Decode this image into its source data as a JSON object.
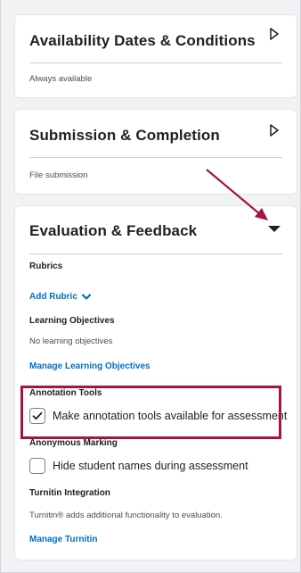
{
  "cards": {
    "availability": {
      "title": "Availability Dates & Conditions",
      "summary": "Always available",
      "icon": "triangle-right-outline-icon"
    },
    "submission": {
      "title": "Submission & Completion",
      "summary": "File submission",
      "icon": "triangle-right-outline-icon"
    },
    "evaluation": {
      "title": "Evaluation & Feedback",
      "icon": "triangle-down-filled-icon",
      "rubrics": {
        "label": "Rubrics",
        "add_link": "Add Rubric"
      },
      "learning_objectives": {
        "label": "Learning Objectives",
        "empty_text": "No learning objectives",
        "manage_link": "Manage Learning Objectives"
      },
      "annotation_tools": {
        "label": "Annotation Tools",
        "checkbox_label": "Make annotation tools available for assessment",
        "checked": true
      },
      "anonymous_marking": {
        "label": "Anonymous Marking",
        "checkbox_label": "Hide student names during assessment",
        "checked": false
      },
      "turnitin": {
        "label": "Turnitin Integration",
        "description": "Turnitin® adds additional functionality to evaluation.",
        "manage_link": "Manage Turnitin"
      }
    }
  },
  "colors": {
    "link": "#006fbf",
    "highlight": "#a3173c",
    "annotation_arrow": "#a3173c"
  }
}
